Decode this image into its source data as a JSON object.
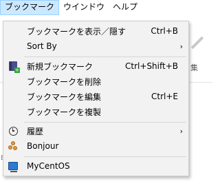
{
  "menubar": {
    "items": [
      {
        "label": "ブックマーク",
        "active": true
      },
      {
        "label": "ウインドウ",
        "active": false
      },
      {
        "label": "ヘルプ",
        "active": false
      }
    ]
  },
  "background": {
    "toolbar_label": "集"
  },
  "bookmark_menu": {
    "items": [
      {
        "label": "ブックマークを表示／隠す",
        "shortcut": "Ctrl+B"
      },
      {
        "label": "Sort By",
        "submenu_arrow": "›"
      },
      {
        "label": "新規ブックマーク",
        "shortcut": "Ctrl+Shift+B",
        "icon": "new-bookmark-icon"
      },
      {
        "label": "ブックマークを削除"
      },
      {
        "label": "ブックマークを編集",
        "shortcut": "Ctrl+E"
      },
      {
        "label": "ブックマークを複製"
      },
      {
        "label": "履歴",
        "submenu_arrow": "›",
        "icon": "history-clock-icon"
      },
      {
        "label": "Bonjour",
        "icon": "bonjour-icon"
      },
      {
        "label": "MyCentOS",
        "icon": "remote-desktop-icon"
      }
    ]
  }
}
